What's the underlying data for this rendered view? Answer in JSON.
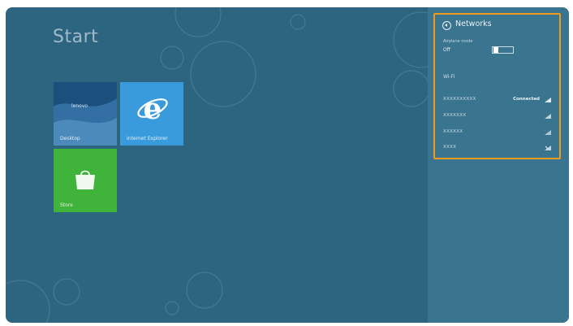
{
  "start": {
    "title": "Start"
  },
  "tiles": [
    {
      "id": "desktop",
      "label": "Desktop",
      "brand": "lenovo",
      "color": "#1d4f7d"
    },
    {
      "id": "internet-explorer",
      "label": "Internet Explorer",
      "color": "#3a9bdc"
    },
    {
      "id": "store",
      "label": "Store",
      "color": "#3fb33a"
    }
  ],
  "networks_panel": {
    "title": "Networks",
    "airplane_mode": {
      "label": "Airplane mode",
      "value": "Off"
    },
    "wifi_heading": "Wi-Fi",
    "networks": [
      {
        "name": "XXXXXXXXXX",
        "status": "Connected"
      },
      {
        "name": "XXXXXXX",
        "status": ""
      },
      {
        "name": "XXXXXX",
        "status": ""
      },
      {
        "name": "XXXX",
        "status": ""
      }
    ],
    "accent_color": "#ef9a1c"
  },
  "icons": [
    "back-icon",
    "ie-logo-icon",
    "store-bag-icon",
    "wifi-signal-icon"
  ],
  "colors": {
    "background": "#2d6580",
    "charm_pane": "#3a7590"
  }
}
